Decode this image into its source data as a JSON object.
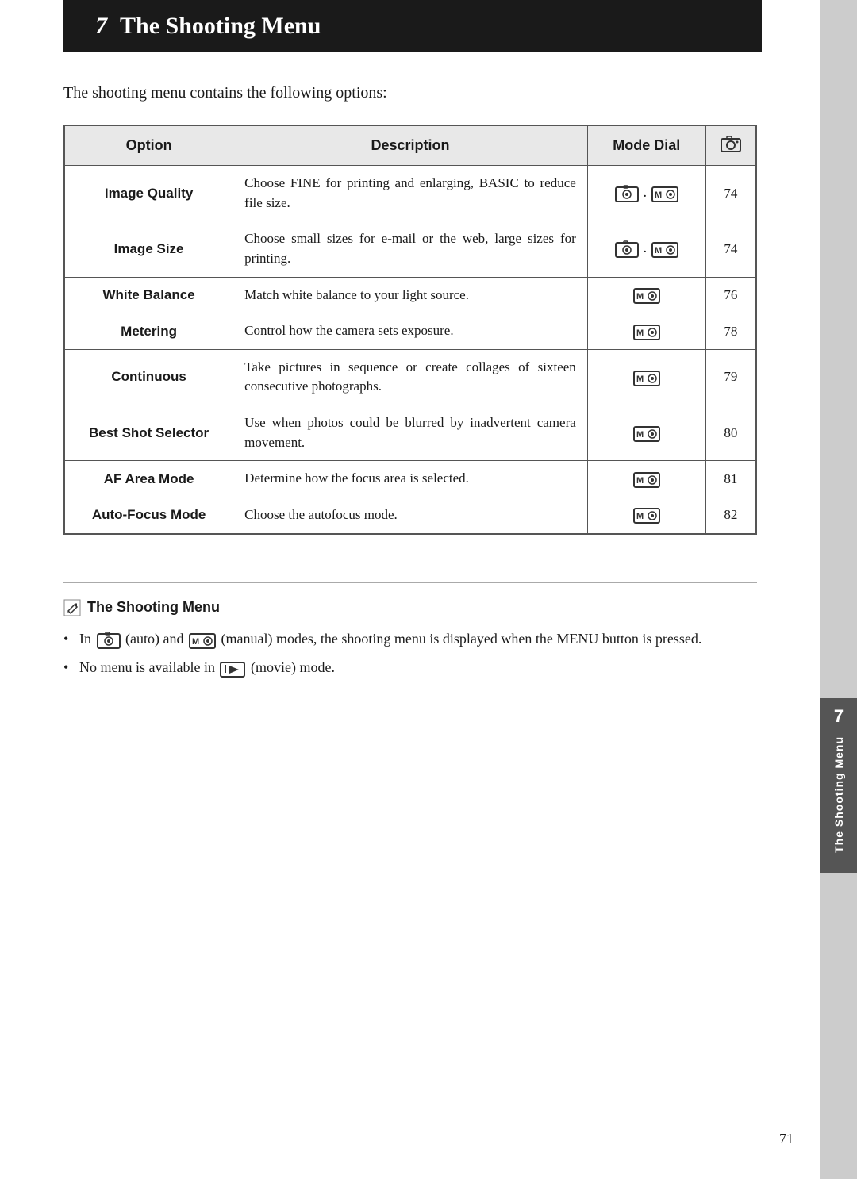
{
  "header": {
    "chapter_number": "7",
    "chapter_title": "The Shooting Menu"
  },
  "intro": "The shooting menu contains the following options:",
  "table": {
    "columns": [
      "Option",
      "Description",
      "Mode Dial",
      "📷"
    ],
    "rows": [
      {
        "option": "Image Quality",
        "description": "Choose FINE for printing and enlarging, BASIC to reduce file size.",
        "mode": "auto_manual",
        "page": "74"
      },
      {
        "option": "Image Size",
        "description": "Choose small sizes for e-mail or the web, large sizes for printing.",
        "mode": "auto_manual",
        "page": "74"
      },
      {
        "option": "White Balance",
        "description": "Match white balance to your light source.",
        "mode": "manual_only",
        "page": "76"
      },
      {
        "option": "Metering",
        "description": "Control how the camera sets exposure.",
        "mode": "manual_only",
        "page": "78"
      },
      {
        "option": "Continuous",
        "description": "Take pictures in sequence or create collages of sixteen consecutive photographs.",
        "mode": "manual_only",
        "page": "79"
      },
      {
        "option": "Best Shot Selector",
        "description": "Use when photos could be blurred by inadvertent camera movement.",
        "mode": "manual_only",
        "page": "80"
      },
      {
        "option": "AF Area Mode",
        "description": "Determine how the focus area is selected.",
        "mode": "manual_only",
        "page": "81"
      },
      {
        "option": "Auto-Focus Mode",
        "description": "Choose the autofocus mode.",
        "mode": "manual_only",
        "page": "82"
      }
    ]
  },
  "note": {
    "title": "The Shooting Menu",
    "bullets": [
      "In  (auto) and  (manual) modes, the shooting menu is displayed when the MENU button is pressed.",
      "No menu is available in  (movie) mode."
    ],
    "bullet1_prefix": "In",
    "bullet1_auto_label": "(auto) and",
    "bullet1_manual_label": "(manual) modes, the shooting menu is displayed when the MENU button is pressed.",
    "bullet2_prefix": "No menu is available in",
    "bullet2_suffix": "(movie) mode."
  },
  "side_tab": {
    "number": "7",
    "label": "The Shooting Menu"
  },
  "page_number": "71"
}
